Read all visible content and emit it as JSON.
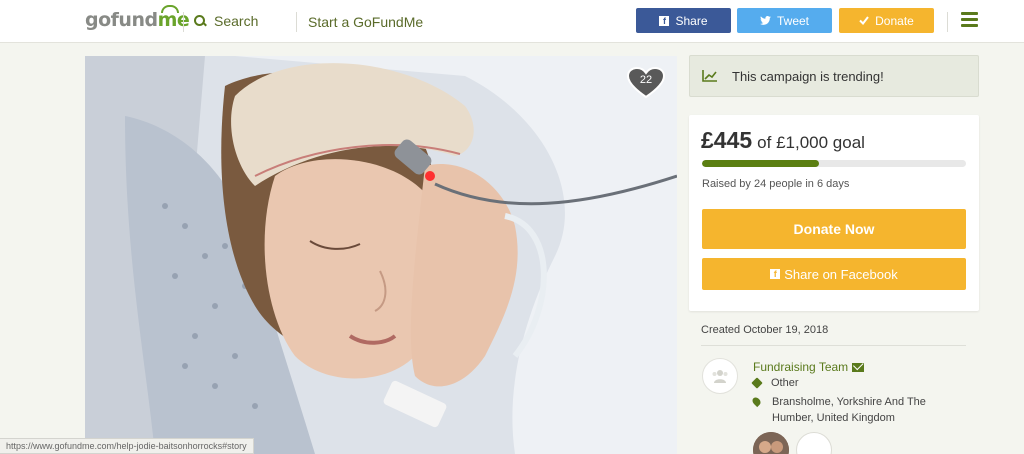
{
  "header": {
    "logo_part1": "gofund",
    "logo_part2": "me",
    "search_label": "Search",
    "start_label": "Start a GoFundMe",
    "share_label": "Share",
    "tweet_label": "Tweet",
    "donate_label": "Donate"
  },
  "photo": {
    "heart_count": "22"
  },
  "trending": {
    "text": "This campaign is trending!"
  },
  "donation": {
    "raised": "£445",
    "goal_text": "of £1,000 goal",
    "progress_fraction": 0.445,
    "raised_by": "Raised by 24 people in 6 days",
    "donate_now_label": "Donate Now",
    "share_fb_label": "Share on Facebook"
  },
  "details": {
    "created": "Created October 19, 2018",
    "team_title": "Fundraising Team",
    "category": "Other",
    "location": "Bransholme, Yorkshire And The Humber, United Kingdom",
    "more_label": "..."
  },
  "status_url": "https://www.gofundme.com/help-jodie-baitsonhorrocks#story",
  "colors": {
    "brand_green": "#5a7a1c",
    "donate_orange": "#f5b52e",
    "facebook_blue": "#3b5998",
    "twitter_blue": "#55acee"
  }
}
